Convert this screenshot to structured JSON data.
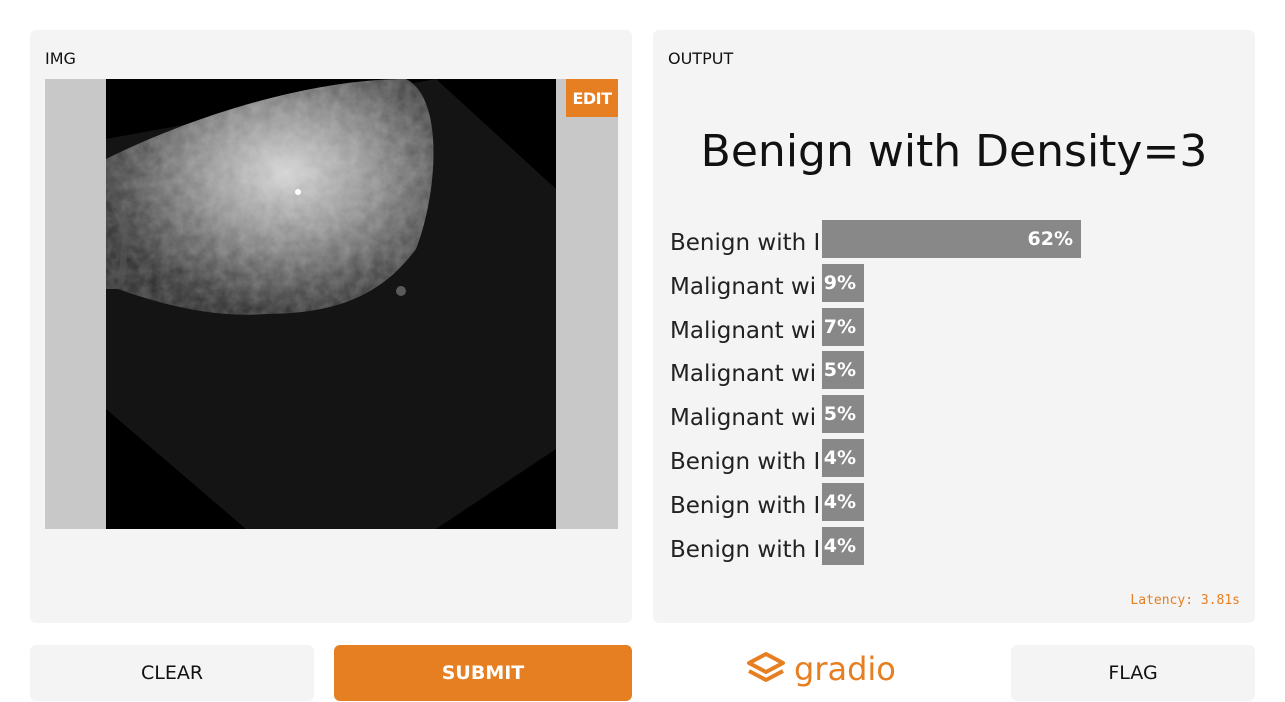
{
  "input": {
    "label": "IMG",
    "edit_label": "EDIT"
  },
  "output": {
    "label": "OUTPUT",
    "result": "Benign with Density=3",
    "confidences": [
      {
        "label": "Benign with I",
        "percent": "62%",
        "value": 0.62
      },
      {
        "label": "Malignant wi",
        "percent": "9%",
        "value": 0.09
      },
      {
        "label": "Malignant wi",
        "percent": "7%",
        "value": 0.07
      },
      {
        "label": "Malignant wi",
        "percent": "5%",
        "value": 0.05
      },
      {
        "label": "Malignant wi",
        "percent": "5%",
        "value": 0.05
      },
      {
        "label": "Benign with I",
        "percent": "4%",
        "value": 0.04
      },
      {
        "label": "Benign with I",
        "percent": "4%",
        "value": 0.04
      },
      {
        "label": "Benign with I",
        "percent": "4%",
        "value": 0.04
      }
    ],
    "latency": "Latency: 3.81s"
  },
  "buttons": {
    "clear": "CLEAR",
    "submit": "SUBMIT",
    "flag": "FLAG"
  },
  "brand": {
    "name": "gradio",
    "color": "#e67e22"
  },
  "colors": {
    "accent": "#e67e22",
    "bar": "#888888",
    "panel": "#f4f4f4"
  }
}
